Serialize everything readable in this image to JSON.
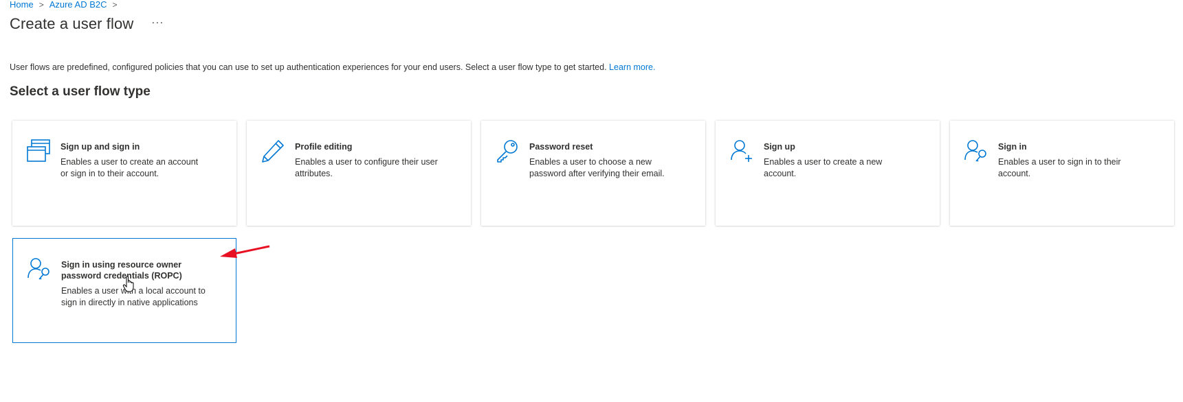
{
  "breadcrumb": {
    "items": [
      "Home",
      "Azure AD B2C"
    ],
    "separator": ">"
  },
  "page": {
    "title": "Create a user flow",
    "more_label": "···",
    "description": "User flows are predefined, configured policies that you can use to set up authentication experiences for your end users. Select a user flow type to get started.",
    "learn_more": "Learn more.",
    "subtitle": "Select a user flow type"
  },
  "cards": [
    {
      "icon": "windows-icon",
      "title": "Sign up and sign in",
      "description": "Enables a user to create an account or sign in to their account."
    },
    {
      "icon": "pencil-icon",
      "title": "Profile editing",
      "description": "Enables a user to configure their user attributes."
    },
    {
      "icon": "key-icon",
      "title": "Password reset",
      "description": "Enables a user to choose a new password after verifying their email."
    },
    {
      "icon": "user-add-icon",
      "title": "Sign up",
      "description": "Enables a user to create a new account."
    },
    {
      "icon": "user-key-icon",
      "title": "Sign in",
      "description": "Enables a user to sign in to their account."
    },
    {
      "icon": "user-key-icon",
      "title": "Sign in using resource owner password credentials (ROPC)",
      "description": "Enables a user with a local account to sign in directly in native applications",
      "selected": true
    }
  ],
  "colors": {
    "accent": "#0078d4",
    "annotation_arrow": "#e81123"
  }
}
